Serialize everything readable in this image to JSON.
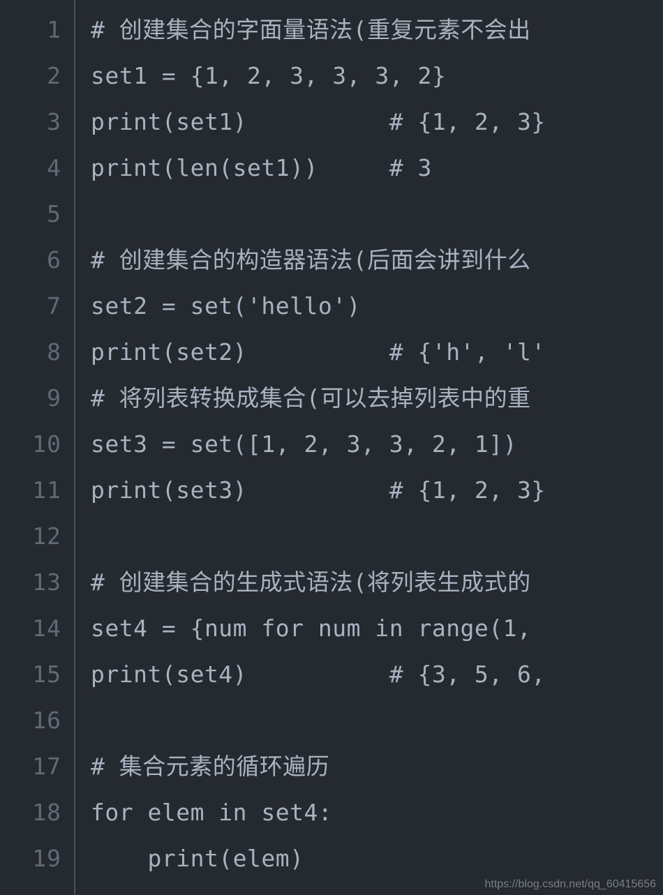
{
  "gutter": {
    "lines": [
      "1",
      "2",
      "3",
      "4",
      "5",
      "6",
      "7",
      "8",
      "9",
      "10",
      "11",
      "12",
      "13",
      "14",
      "15",
      "16",
      "17",
      "18",
      "19"
    ]
  },
  "code": {
    "lines": [
      "# 创建集合的字面量语法(重复元素不会出",
      "set1 = {1, 2, 3, 3, 3, 2}",
      "print(set1)          # {1, 2, 3}",
      "print(len(set1))     # 3",
      "",
      "# 创建集合的构造器语法(后面会讲到什么",
      "set2 = set('hello')",
      "print(set2)          # {'h', 'l'",
      "# 将列表转换成集合(可以去掉列表中的重",
      "set3 = set([1, 2, 3, 3, 2, 1])",
      "print(set3)          # {1, 2, 3}",
      "",
      "# 创建集合的生成式语法(将列表生成式的",
      "set4 = {num for num in range(1, ",
      "print(set4)          # {3, 5, 6, ",
      "",
      "# 集合元素的循环遍历",
      "for elem in set4:",
      "    print(elem)"
    ]
  },
  "watermark": "https://blog.csdn.net/qq_60415656"
}
